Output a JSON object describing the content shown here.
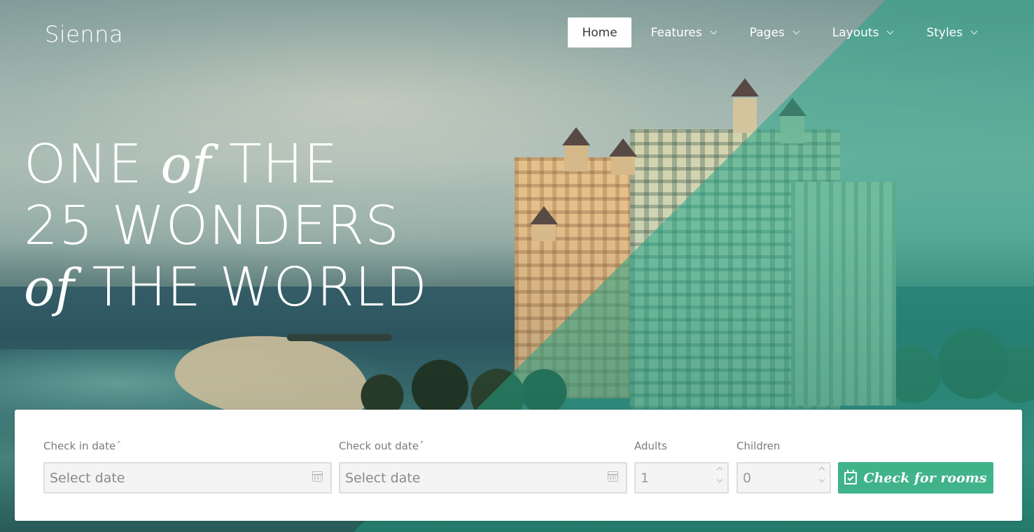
{
  "brand": {
    "name": "Sienna"
  },
  "nav": {
    "items": [
      {
        "label": "Home",
        "active": true,
        "has_dropdown": false
      },
      {
        "label": "Features",
        "active": false,
        "has_dropdown": true
      },
      {
        "label": "Pages",
        "active": false,
        "has_dropdown": true
      },
      {
        "label": "Layouts",
        "active": false,
        "has_dropdown": true
      },
      {
        "label": "Styles",
        "active": false,
        "has_dropdown": true
      }
    ]
  },
  "hero": {
    "line1": {
      "a": "ONE",
      "b": "of",
      "c": "THE"
    },
    "line2": "25 WONDERS",
    "line3": {
      "a": "of",
      "b": "THE WORLD"
    }
  },
  "booking": {
    "check_in": {
      "label": "Check in date",
      "required_mark": "*",
      "placeholder": "Select date",
      "icon": "calendar-icon"
    },
    "check_out": {
      "label": "Check out date",
      "required_mark": "*",
      "placeholder": "Select date",
      "icon": "calendar-icon"
    },
    "adults": {
      "label": "Adults",
      "value": "1"
    },
    "children": {
      "label": "Children",
      "value": "0"
    },
    "submit": {
      "label": "Check for rooms",
      "icon": "calendar-check-icon"
    }
  },
  "colors": {
    "accent": "#41b38b",
    "overlay_teal": "#26aa8c",
    "text_light": "#ffffff",
    "label_gray": "#7b7b7b"
  }
}
